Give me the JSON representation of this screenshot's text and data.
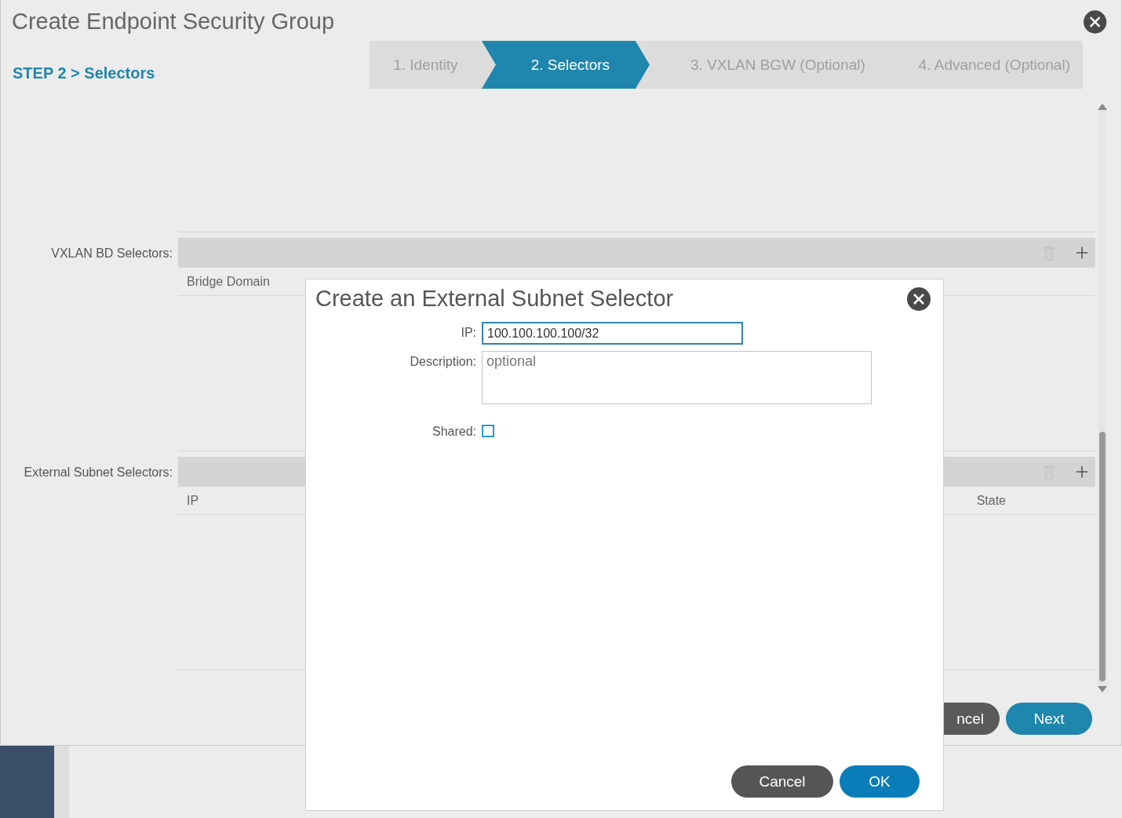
{
  "window": {
    "title": "Create Endpoint Security Group",
    "step": "STEP 2 > Selectors"
  },
  "steps": [
    {
      "label": "1. Identity",
      "selected": false
    },
    {
      "label": "2. Selectors",
      "selected": true
    },
    {
      "label": "3. VXLAN BGW (Optional)",
      "selected": false
    },
    {
      "label": "4. Advanced (Optional)",
      "selected": false
    }
  ],
  "sections": [
    {
      "label": "VXLAN BD Selectors:",
      "columns": [
        "Bridge Domain"
      ]
    },
    {
      "label": "External Subnet Selectors:",
      "columns": [
        "IP",
        "State"
      ]
    }
  ],
  "footer_buttons": [
    {
      "label": "ncel",
      "kind": "secondary"
    },
    {
      "label": "Next",
      "kind": "primary"
    }
  ],
  "dialog": {
    "title": "Create an External Subnet Selector",
    "fields": [
      {
        "kind": "text",
        "label": "IP:",
        "value": "100.100.100.100/32"
      },
      {
        "kind": "textarea",
        "label": "Description:",
        "placeholder": "optional"
      },
      {
        "kind": "checkbox",
        "label": "Shared:",
        "checked": false
      }
    ],
    "buttons": [
      {
        "label": "Cancel",
        "kind": "secondary"
      },
      {
        "label": "OK",
        "kind": "primary"
      }
    ]
  }
}
